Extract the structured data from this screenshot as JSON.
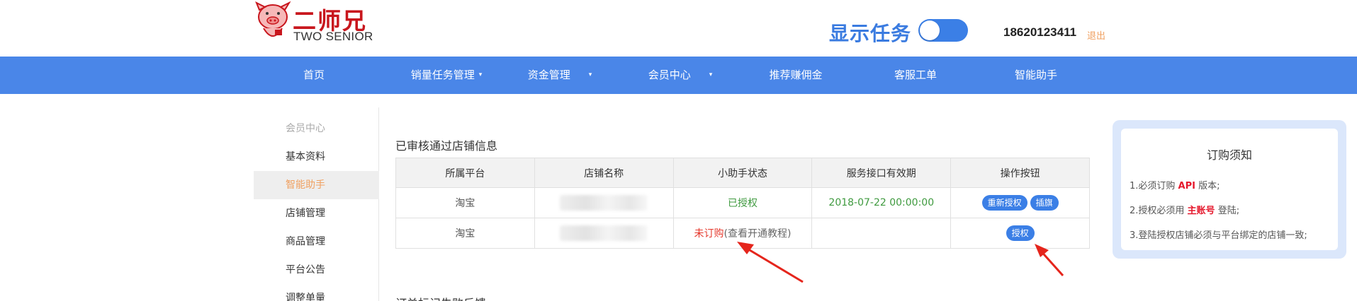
{
  "header": {
    "logo_cn": "二师兄",
    "logo_en": "TWO SENIOR",
    "task_toggle_label": "显示任务",
    "task_toggle_on": true,
    "phone": "18620123411",
    "logout": "退出"
  },
  "nav": {
    "items": [
      {
        "label": "首页",
        "dropdown": false
      },
      {
        "label": "销量任务管理",
        "dropdown": true
      },
      {
        "label": "资金管理",
        "dropdown": true
      },
      {
        "label": "会员中心",
        "dropdown": true
      },
      {
        "label": "推荐赚佣金",
        "dropdown": false
      },
      {
        "label": "客服工单",
        "dropdown": false
      },
      {
        "label": "智能助手",
        "dropdown": false
      }
    ],
    "caret_symbol": "▾"
  },
  "sidebar": {
    "section": "会员中心",
    "items": [
      {
        "label": "基本资料"
      },
      {
        "label": "智能助手",
        "active": true
      },
      {
        "label": "店铺管理"
      },
      {
        "label": "商品管理"
      },
      {
        "label": "平台公告"
      },
      {
        "label": "调整单量"
      }
    ]
  },
  "main": {
    "section_title": "已审核通过店铺信息",
    "section_title_2": "订单标记失败反馈",
    "table": {
      "headers": [
        "所属平台",
        "店铺名称",
        "小助手状态",
        "服务接口有效期",
        "操作按钮"
      ],
      "rows": [
        {
          "platform": "淘宝",
          "store_name": "",
          "status": "已授权",
          "status_extra": "",
          "expiry": "2018-07-22 00:00:00",
          "buttons": [
            "重新授权",
            "插旗"
          ]
        },
        {
          "platform": "淘宝",
          "store_name": "",
          "status": "未订购",
          "status_extra": "(查看开通教程)",
          "expiry": "",
          "buttons": [
            "授权"
          ]
        }
      ]
    }
  },
  "notice": {
    "title": "订购须知",
    "lines": [
      {
        "prefix": "1.必须订购 ",
        "highlight": "API",
        "suffix": " 版本;"
      },
      {
        "prefix": "2.授权必须用 ",
        "highlight": "主账号",
        "suffix": " 登陆;"
      },
      {
        "prefix": "3.登陆授权店铺必须与平台绑定的店铺一致;",
        "highlight": "",
        "suffix": ""
      }
    ]
  },
  "colors": {
    "nav_bg": "#4a86e8",
    "brand_red": "#c8161d",
    "accent_blue": "#3b7fe6",
    "active_orange": "#f0a060",
    "ok_green": "#3f9a3f",
    "warn_red": "#e5382c"
  }
}
